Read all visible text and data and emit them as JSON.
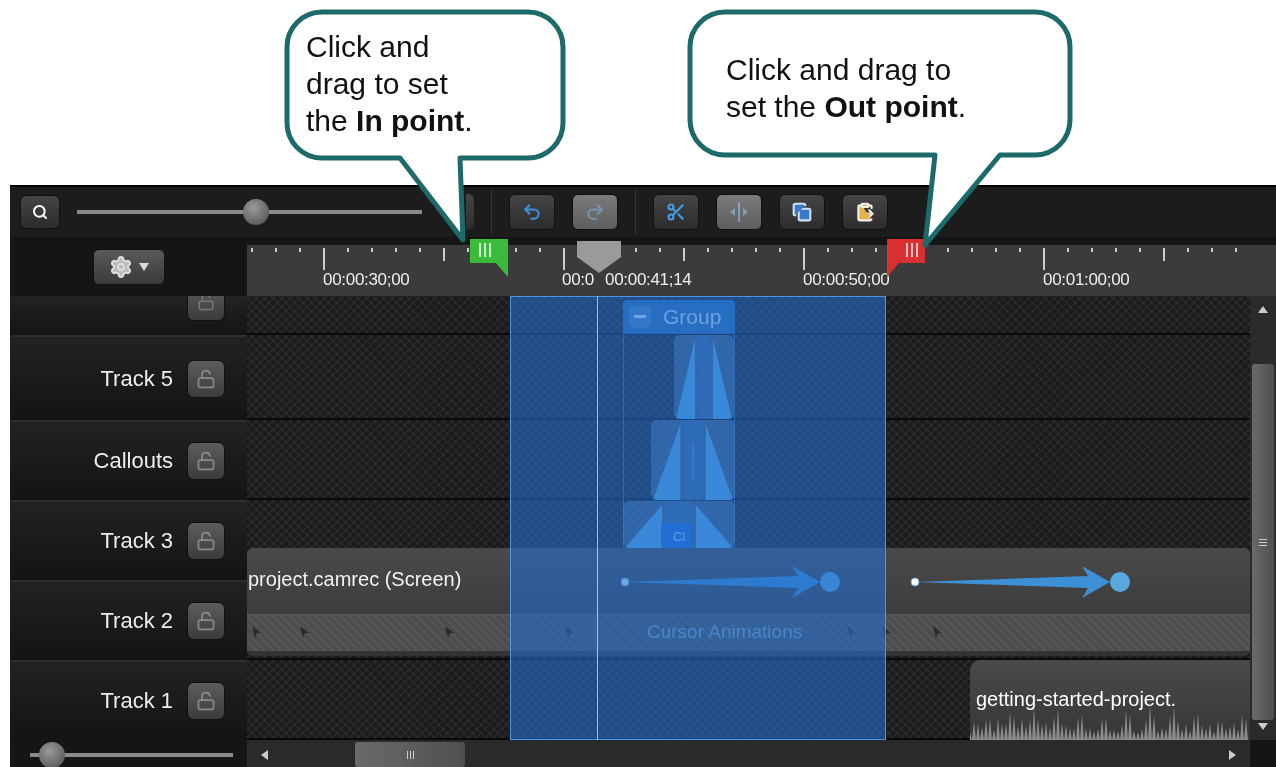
{
  "callouts": [
    {
      "text": "Click and\ndrag to set\nthe **In point**."
    },
    {
      "text": "Click and drag to\nset the **Out point**."
    }
  ],
  "toolbar": {
    "zoom_slider": {
      "level": 0.52
    },
    "buttons": [
      {
        "kind": "undo",
        "disabled": false
      },
      {
        "kind": "redo",
        "disabled": true
      },
      {
        "kind": "cut",
        "disabled": false
      },
      {
        "kind": "split",
        "disabled": true
      },
      {
        "kind": "copy",
        "disabled": false
      },
      {
        "kind": "paste",
        "disabled": false
      }
    ]
  },
  "ruler": {
    "labels": [
      "00:00:30;00",
      "00:0",
      "00:00:50;00",
      "00:01:00;00"
    ],
    "playhead": "00:00:41;14"
  },
  "tracks": [
    {
      "name": "Track 5",
      "locked": false
    },
    {
      "name": "Callouts",
      "locked": false
    },
    {
      "name": "Track 3",
      "locked": false
    },
    {
      "name": "Track 2",
      "locked": false
    },
    {
      "name": "Track 1",
      "locked": false
    }
  ],
  "clips": {
    "group": {
      "label": "Group",
      "expanded": true
    },
    "callout_label": "Cl",
    "screen": {
      "label": "project.camrec (Screen)",
      "band": "Cursor Animations"
    },
    "audio": {
      "label": "getting-started-project."
    }
  },
  "track_height_slider": {
    "level": 0.05
  }
}
